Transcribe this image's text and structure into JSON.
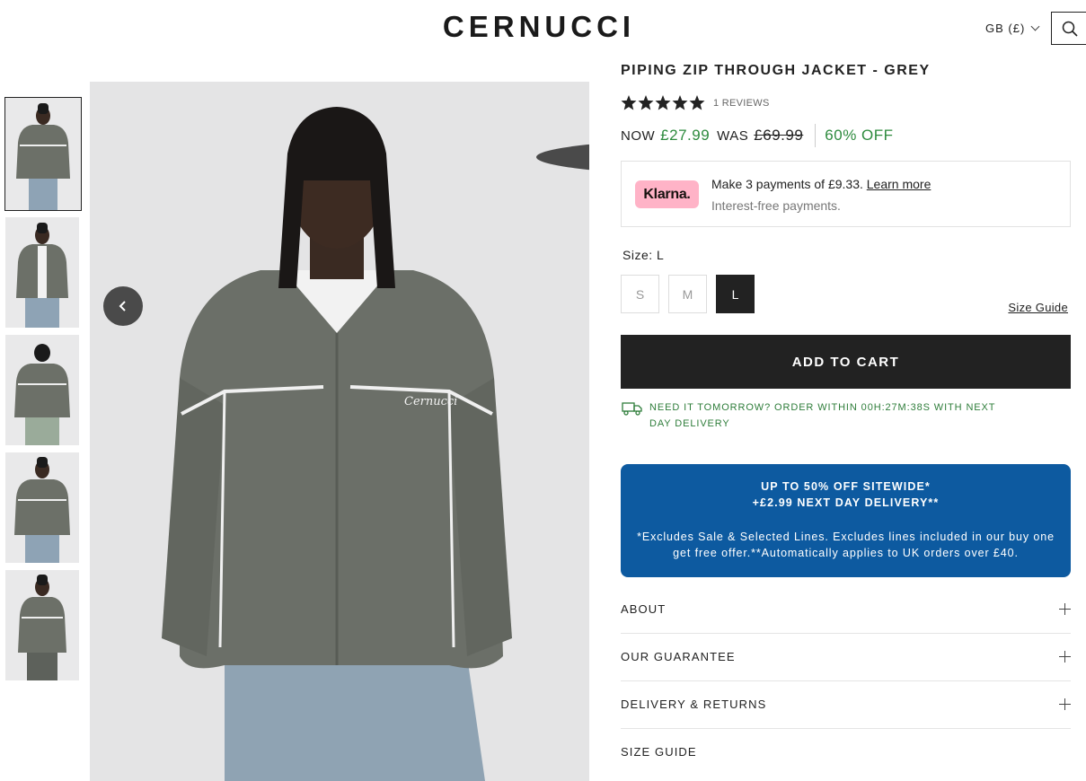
{
  "header": {
    "brand": "CERNUCCI",
    "locale_label": "GB (£)",
    "icons": {
      "search": "search-icon",
      "locale": "chevron-down-icon"
    }
  },
  "gallery": {
    "thumbnails": [
      "front view",
      "front open",
      "back view",
      "front hands in pockets",
      "side view"
    ],
    "active_index": 0,
    "prev_icon": "chevron-left-icon",
    "next_icon": "chevron-right-icon"
  },
  "product": {
    "title": "PIPING ZIP THROUGH JACKET - GREY",
    "rating": 5,
    "reviews_label": "1 REVIEWS",
    "now_label": "NOW",
    "now_price": "£27.99",
    "was_label": "WAS",
    "was_price": "£69.99",
    "discount": "60% OFF"
  },
  "klarna": {
    "badge": "Klarna.",
    "line1": "Make 3 payments of £9.33.",
    "learn_more": "Learn more",
    "line2": "Interest-free payments."
  },
  "sizes": {
    "label": "Size: L",
    "options": [
      "S",
      "M",
      "L"
    ],
    "selected": "L",
    "guide_link": "Size Guide"
  },
  "cart": {
    "button_label": "ADD TO CART"
  },
  "delivery": {
    "text": "NEED IT TOMORROW? ORDER WITHIN 00H:27M:38S WITH NEXT DAY DELIVERY"
  },
  "promo": {
    "line1": "UP TO 50% OFF SITEWIDE*",
    "line2": "+£2.99 NEXT DAY DELIVERY**",
    "note": "*Excludes Sale & Selected Lines. Excludes lines included in our buy one get free offer.**Automatically applies to UK orders over £40."
  },
  "accordion": [
    {
      "label": "ABOUT"
    },
    {
      "label": "OUR GUARANTEE"
    },
    {
      "label": "DELIVERY & RETURNS"
    },
    {
      "label": "SIZE GUIDE"
    }
  ],
  "colors": {
    "accent_green": "#2e8b3e",
    "promo_blue": "#0d5aa0",
    "klarna_pink": "#ffb3c7",
    "dark": "#222222"
  }
}
